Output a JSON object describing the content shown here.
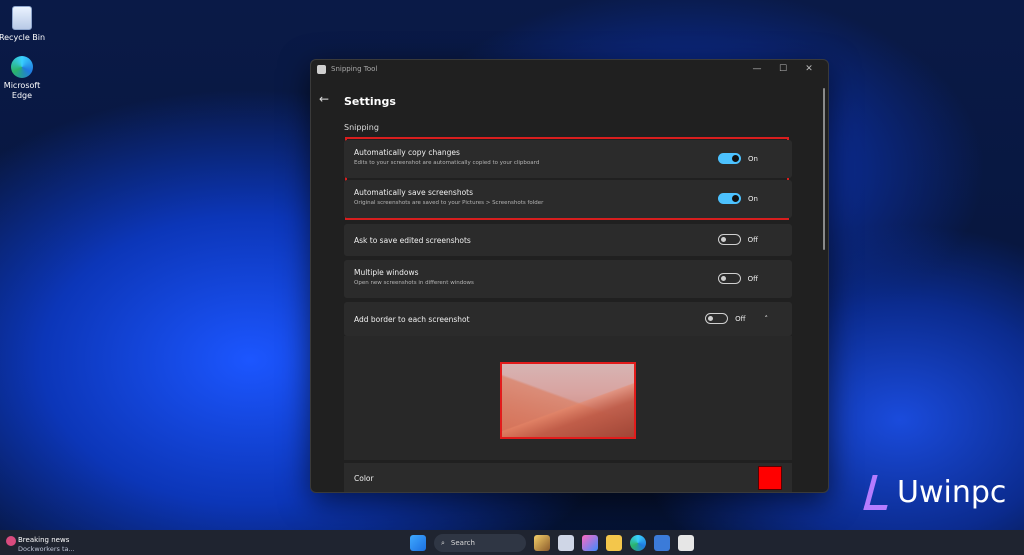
{
  "desktop": {
    "icons": [
      {
        "label": "Recycle Bin"
      },
      {
        "label": "Microsoft Edge"
      }
    ]
  },
  "window": {
    "title": "Snipping Tool",
    "controls": [
      "—",
      "☐",
      "✕"
    ],
    "back_glyph": "←",
    "page_title": "Settings",
    "section": "Snipping",
    "settings": [
      {
        "title": "Automatically copy changes",
        "desc": "Edits to your screenshot are automatically copied to your clipboard",
        "state": "On"
      },
      {
        "title": "Automatically save screenshots",
        "desc": "Original screenshots are saved to your Pictures > Screenshots folder",
        "state": "On"
      },
      {
        "title": "Ask to save edited screenshots",
        "desc": "",
        "state": "Off"
      },
      {
        "title": "Multiple windows",
        "desc": "Open new screenshots in different windows",
        "state": "Off"
      },
      {
        "title": "Add border to each screenshot",
        "desc": "",
        "state": "Off",
        "chevron": "˄"
      }
    ],
    "color_label": "Color",
    "border_color": "#ff0000",
    "accent_color": "#4cc2ff"
  },
  "watermark": "Uwinpc",
  "taskbar": {
    "news_title": "Breaking news",
    "news_sub": "Dockworkers ta...",
    "search_label": "Search",
    "icons": [
      "start-icon",
      "search-icon",
      "paint-icon",
      "task-view-icon",
      "copilot-icon",
      "file-explorer-icon",
      "edge-icon",
      "store-icon",
      "snipping-tool-icon"
    ]
  }
}
